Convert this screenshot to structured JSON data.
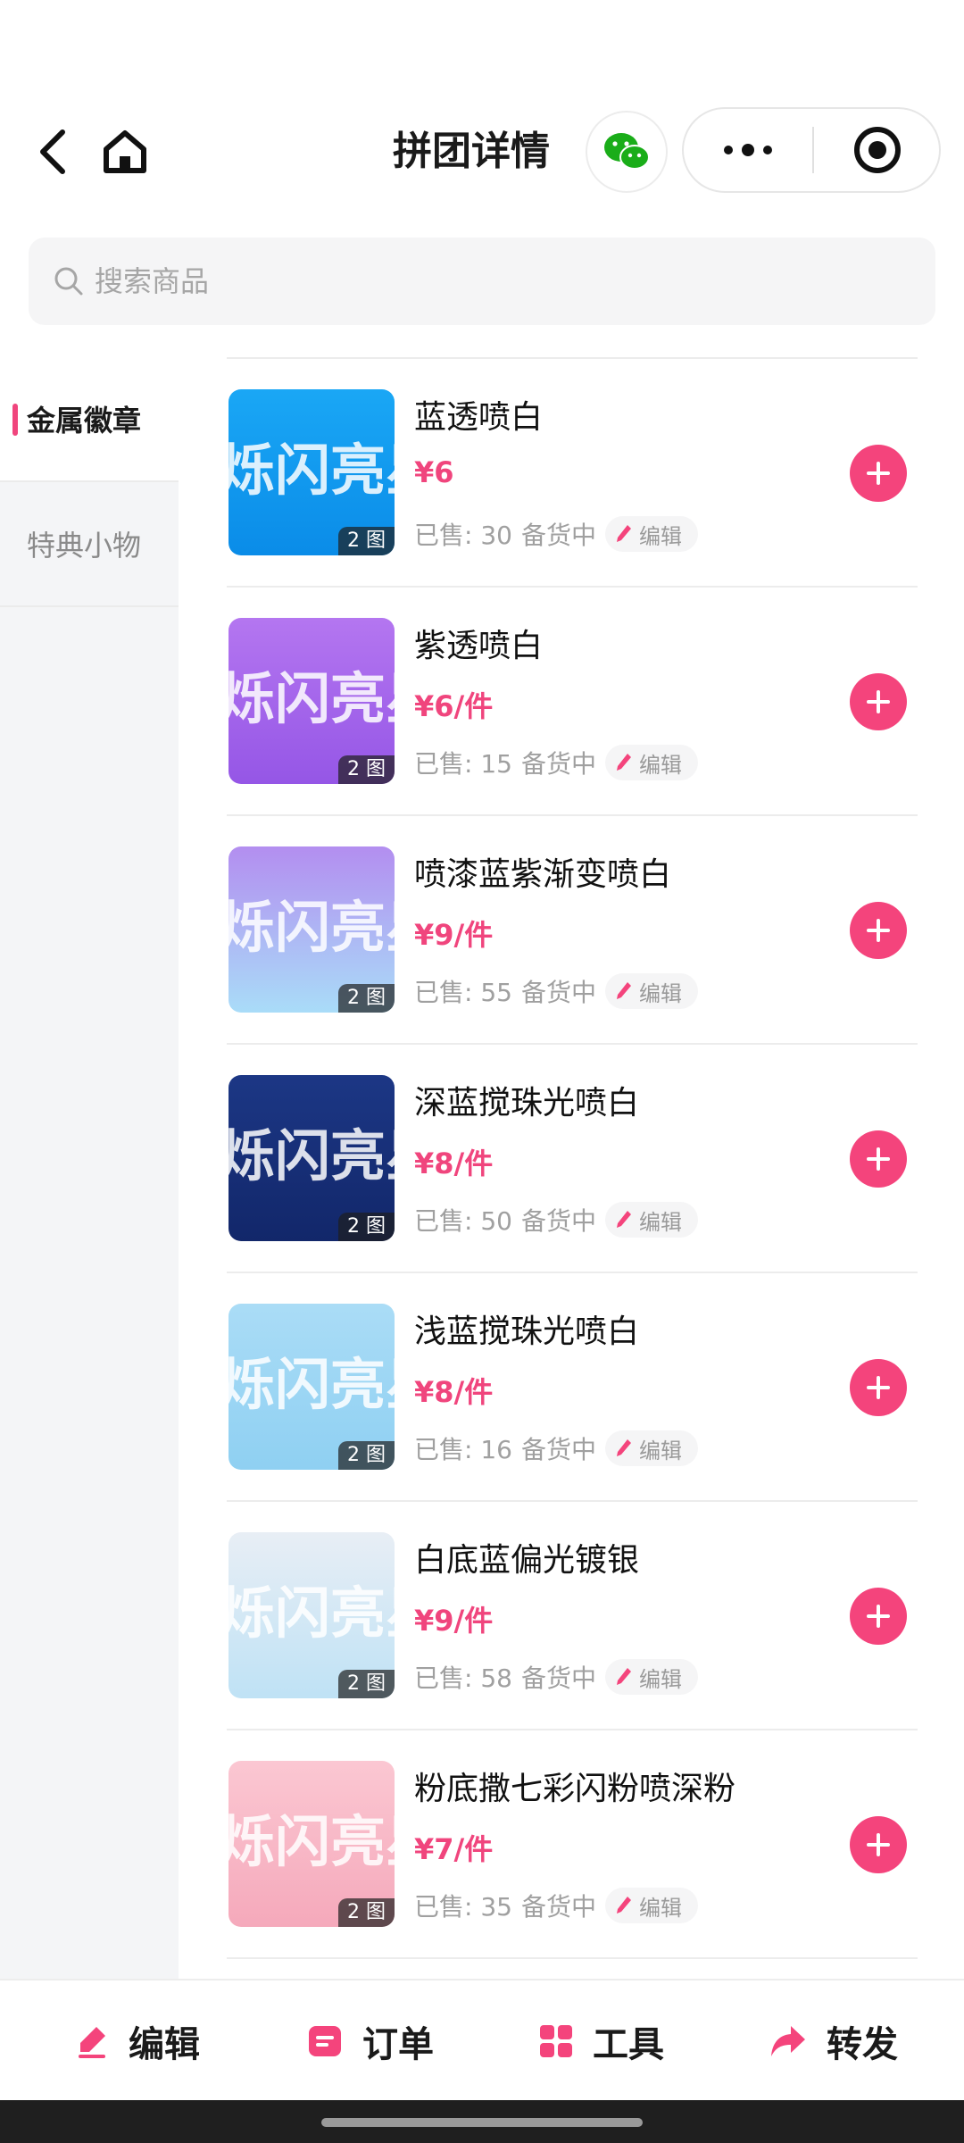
{
  "header": {
    "title": "拼团详情"
  },
  "search": {
    "placeholder": "搜索商品"
  },
  "categories": [
    {
      "label": "金属徽章",
      "active": true
    },
    {
      "label": "特典小物",
      "active": false
    }
  ],
  "products": [
    {
      "name": "蓝透喷白",
      "price": "¥6",
      "sold": "已售: 30",
      "status": "备货中",
      "edit_label": "编辑",
      "image_badge": "2 图",
      "thumb_colors": [
        "#1aa7f5",
        "#0a8ce8"
      ]
    },
    {
      "name": "紫透喷白",
      "price": "¥6/件",
      "sold": "已售: 15",
      "status": "备货中",
      "edit_label": "编辑",
      "image_badge": "2 图",
      "thumb_colors": [
        "#b476f0",
        "#9556e6"
      ]
    },
    {
      "name": "喷漆蓝紫渐变喷白",
      "price": "¥9/件",
      "sold": "已售: 55",
      "status": "备货中",
      "edit_label": "编辑",
      "image_badge": "2 图",
      "thumb_colors": [
        "#b38ef0",
        "#a9dcf8"
      ]
    },
    {
      "name": "深蓝搅珠光喷白",
      "price": "¥8/件",
      "sold": "已售: 50",
      "status": "备货中",
      "edit_label": "编辑",
      "image_badge": "2 图",
      "thumb_colors": [
        "#1c3785",
        "#12276a"
      ]
    },
    {
      "name": "浅蓝搅珠光喷白",
      "price": "¥8/件",
      "sold": "已售: 16",
      "status": "备货中",
      "edit_label": "编辑",
      "image_badge": "2 图",
      "thumb_colors": [
        "#aadcf6",
        "#8fd0f2"
      ]
    },
    {
      "name": "白底蓝偏光镀银",
      "price": "¥9/件",
      "sold": "已售: 58",
      "status": "备货中",
      "edit_label": "编辑",
      "image_badge": "2 图",
      "thumb_colors": [
        "#e8eef5",
        "#bfe2f5"
      ]
    },
    {
      "name": "粉底撒七彩闪粉喷深粉",
      "price": "¥7/件",
      "sold": "已售: 35",
      "status": "备货中",
      "edit_label": "编辑",
      "image_badge": "2 图",
      "thumb_colors": [
        "#fbc7d2",
        "#f5a9bb"
      ]
    }
  ],
  "thumb_art_text": "烁闪亮星",
  "bottom_actions": {
    "edit": "编辑",
    "orders": "订单",
    "tools": "工具",
    "share": "转发"
  },
  "colors": {
    "accent": "#f4447c",
    "sidebar_bg": "#f4f5f7",
    "wechat_green": "#1aad19"
  },
  "icons": [
    "back-arrow-icon",
    "home-icon",
    "wechat-icon",
    "more-dots-icon",
    "close-target-icon",
    "search-icon",
    "pencil-icon",
    "plus-icon",
    "order-icon",
    "tools-grid-icon",
    "share-arrow-icon"
  ]
}
